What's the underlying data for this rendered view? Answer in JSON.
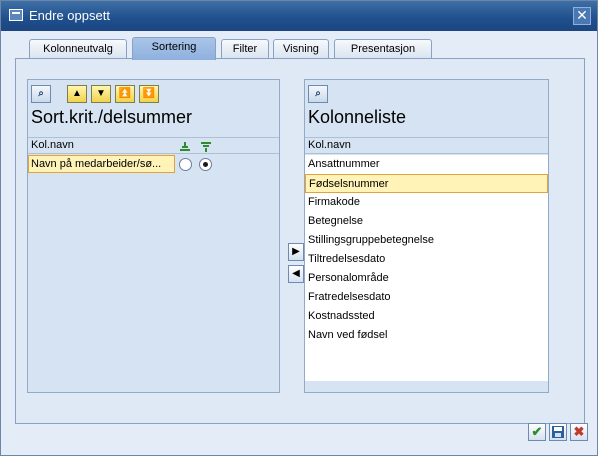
{
  "window": {
    "title": "Endre oppsett",
    "close_glyph": "✕"
  },
  "tabs": [
    {
      "label": "Kolonneutvalg",
      "active": false
    },
    {
      "label": "Sortering",
      "active": true
    },
    {
      "label": "Filter",
      "active": false
    },
    {
      "label": "Visning",
      "active": false
    },
    {
      "label": "Presentasjon",
      "active": false
    }
  ],
  "left_panel": {
    "title": "Sort.krit./delsummer",
    "column_header": "Kol.navn",
    "toolbar_icons": [
      "find-icon",
      "up-icon",
      "down-icon",
      "top-icon",
      "bottom-icon"
    ],
    "rows": [
      {
        "name": "Navn på medarbeider/sø...",
        "ascending_selected": false,
        "descending_selected": true
      }
    ]
  },
  "right_panel": {
    "title": "Kolonneliste",
    "column_header": "Kol.navn",
    "items": [
      "Ansattnummer",
      "Fødselsnummer",
      "Firmakode",
      "Betegnelse",
      "Stillingsgruppebetegnelse",
      "Tiltredelsesdato",
      "Personalområde",
      "Fratredelsesdato",
      "Kostnadssted",
      "Navn ved fødsel"
    ],
    "selected_index": 1
  },
  "move_buttons": {
    "right_glyph": "▶",
    "left_glyph": "◀"
  },
  "footer": {
    "ok_glyph": "✔",
    "save_glyph": "💾",
    "cancel_glyph": "✖",
    "ok_color": "#2e8b2e",
    "cancel_color": "#c0392b"
  }
}
